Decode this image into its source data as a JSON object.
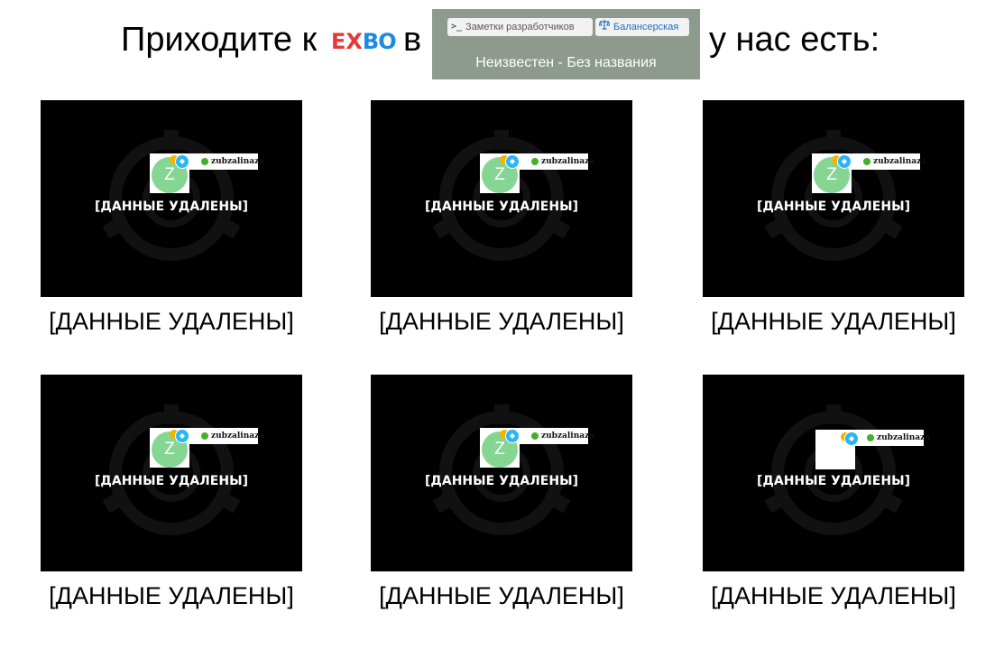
{
  "header": {
    "text_before": "Приходите к",
    "logo": {
      "part1": "E",
      "part2": "X",
      "part3": "BO",
      "colors": {
        "red": "#e53935",
        "blue": "#1e88e5"
      }
    },
    "text_between": "в",
    "text_after": "у нас есть:",
    "tags": {
      "dev_label": "Заметки разработчиков",
      "dev_icon": "terminal-icon",
      "balance_label": "Балансерская",
      "balance_icon": "scales-icon"
    },
    "status": "Неизвестен - Без названия"
  },
  "cards": [
    {
      "avatar_letter": "Z",
      "username": "zubzalinaza",
      "overlay": "[ДАННЫЕ УДАЛЕНЫ]",
      "caption": "[ДАННЫЕ УДАЛЕНЫ]"
    },
    {
      "avatar_letter": "Z",
      "username": "zubzalinaza",
      "overlay": "[ДАННЫЕ УДАЛЕНЫ]",
      "caption": "[ДАННЫЕ УДАЛЕНЫ]"
    },
    {
      "avatar_letter": "Z",
      "username": "zubzalinaza",
      "overlay": "[ДАННЫЕ УДАЛЕНЫ]",
      "caption": "[ДАННЫЕ УДАЛЕНЫ]"
    },
    {
      "avatar_letter": "Z",
      "username": "zubzalinaza",
      "overlay": "[ДАННЫЕ УДАЛЕНЫ]",
      "caption": "[ДАННЫЕ УДАЛЕНЫ]"
    },
    {
      "avatar_letter": "Z",
      "username": "zubzalinaza",
      "overlay": "[ДАННЫЕ УДАЛЕНЫ]",
      "caption": "[ДАННЫЕ УДАЛЕНЫ]"
    },
    {
      "avatar_letter": "",
      "username": "zubzalinaza",
      "overlay": "[ДАННЫЕ УДАЛЕНЫ]",
      "caption": "[ДАННЫЕ УДАЛЕНЫ]"
    }
  ],
  "colors": {
    "tag_box_bg": "#8d9a8d",
    "avatar_bg": "#86d693",
    "online": "#43b02a",
    "gem": "#29b6f6"
  }
}
